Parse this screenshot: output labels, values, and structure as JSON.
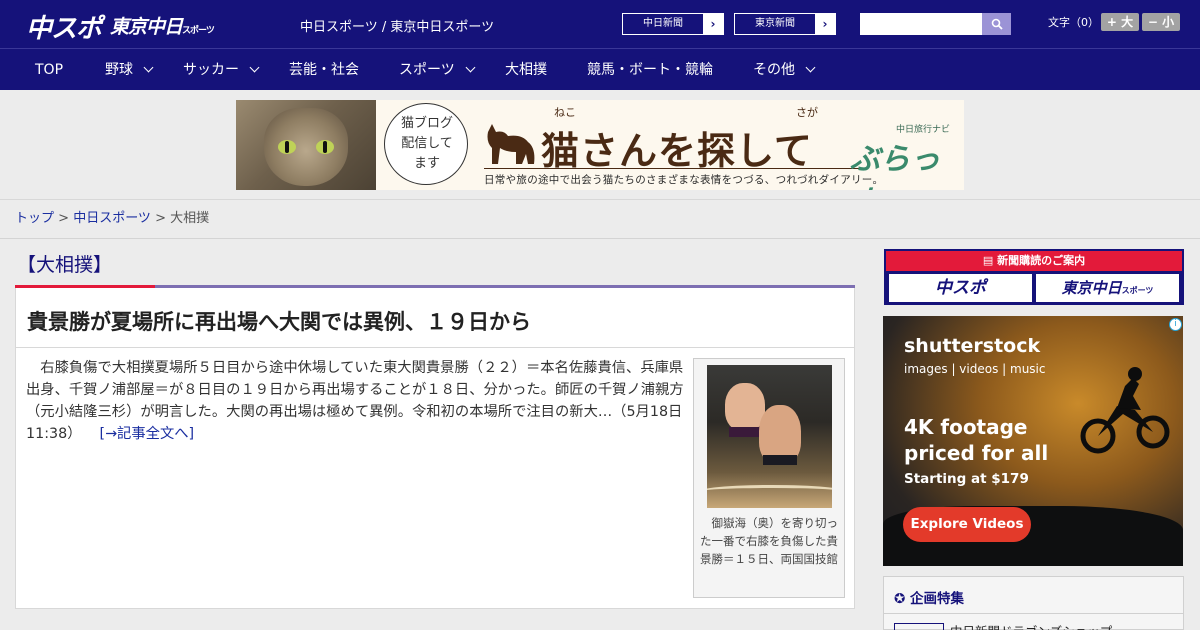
{
  "header": {
    "logo_chuspo": "中スポ",
    "logo_tokyo_main": "東京中日",
    "logo_tokyo_small": "スポーツ",
    "sites_label": "中日スポーツ / 東京中日スポーツ",
    "links": [
      {
        "label": "中日新聞"
      },
      {
        "label": "東京新聞"
      }
    ],
    "search": {
      "value": "",
      "placeholder": ""
    },
    "font_size": {
      "label": "文字（0）",
      "increase": "+ 大",
      "decrease": "− 小"
    }
  },
  "nav": [
    {
      "label": "TOP",
      "dropdown": false
    },
    {
      "label": "野球",
      "dropdown": true
    },
    {
      "label": "サッカー",
      "dropdown": true
    },
    {
      "label": "芸能・社会",
      "dropdown": false
    },
    {
      "label": "スポーツ",
      "dropdown": true
    },
    {
      "label": "大相撲",
      "dropdown": false
    },
    {
      "label": "競馬・ボート・競輪",
      "dropdown": false
    },
    {
      "label": "その他",
      "dropdown": true
    }
  ],
  "banner": {
    "bubble": "猫ブログ配信してます",
    "ruby_1": "ねこ",
    "ruby_2": "さが",
    "title": "猫さんを探して",
    "brand_small": "中日旅行ナビ",
    "brand": "ぶらっ人",
    "subtitle": "日常や旅の途中で出会う猫たちのさまざまな表情をつづる、つれづれダイアリー。"
  },
  "breadcrumb": {
    "top": "トップ",
    "sep": " > ",
    "section": "中日スポーツ",
    "current": "大相撲"
  },
  "main": {
    "category": "【大相撲】",
    "headline": "貴景勝が夏場所に再出場へ大関では異例、１９日から",
    "summary": "右膝負傷で大相撲夏場所５日目から途中休場していた東大関貴景勝（２２）＝本名佐藤貴信、兵庫県出身、千賀ノ浦部屋＝が８日目の１９日から再出場することが１８日、分かった。師匠の千賀ノ浦親方（元小結隆三杉）が明言した。大関の再出場は極めて異例。令和初の本場所で注目の新大…（5月18日 11:38）",
    "more": "[→記事全文へ]",
    "photo_caption": "御嶽海（奥）を寄り切った一番で右膝を負傷した貴景勝＝１５日、両国国技館"
  },
  "sidebar": {
    "subscribe": {
      "title": "新聞購読のご案内",
      "logo_chuspo": "中スポ",
      "logo_tokyo_main": "東京中日",
      "logo_tokyo_small": "スポーツ"
    },
    "ad": {
      "logo": "shutterstock",
      "sub": "images  |  videos  |  music",
      "headline": "4K footage priced for all",
      "price": "Starting at $179",
      "cta": "Explore Videos",
      "info": "i"
    },
    "feature": {
      "title": "企画特集",
      "item": "中日新聞ドラゴンズショップ"
    }
  },
  "colors": {
    "brand_navy": "#15127a",
    "accent_red": "#e31a3a",
    "accent_purple": "#7d6fb2",
    "link_blue": "#1a2ea0",
    "ad_cta": "#e33a2a"
  },
  "icons": [
    "search-icon",
    "chevron-down-icon",
    "chevron-right-icon",
    "newspaper-icon",
    "ribbon-icon",
    "info-icon"
  ]
}
